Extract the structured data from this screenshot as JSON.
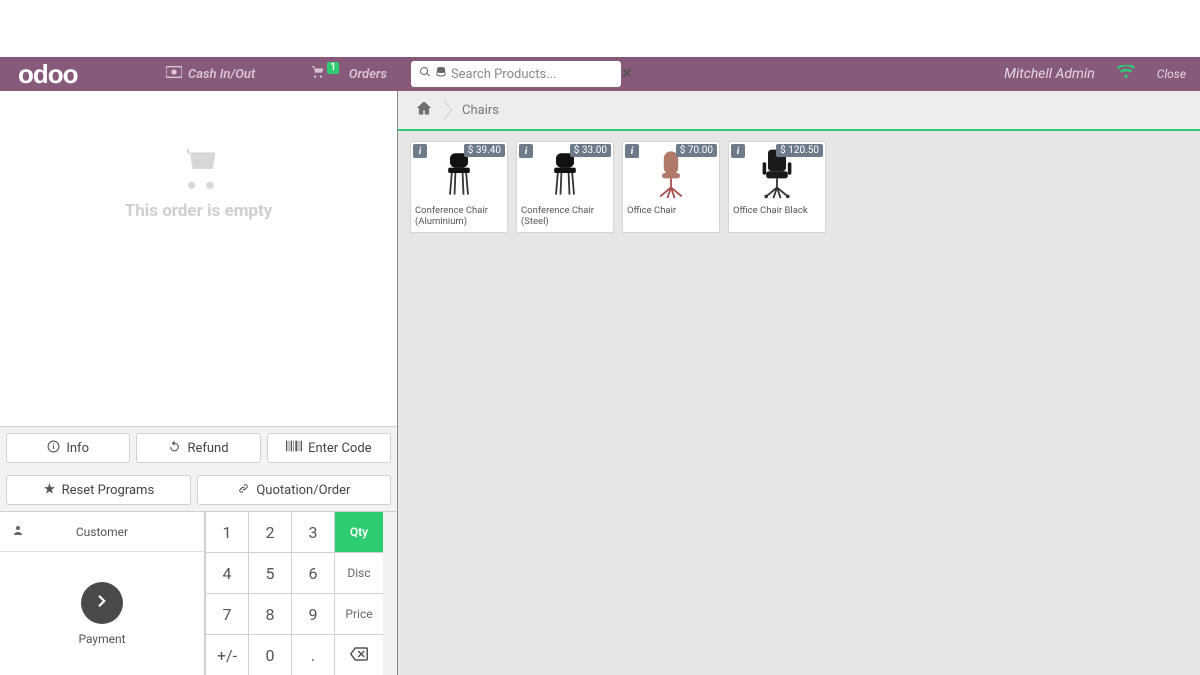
{
  "brand": "odoo",
  "topbar": {
    "cash_label": "Cash In/Out",
    "orders_label": "Orders",
    "orders_count": "1",
    "search_placeholder": "Search Products...",
    "user": "Mitchell Admin",
    "close_label": "Close"
  },
  "order": {
    "empty_message": "This order is empty"
  },
  "actions": {
    "info": "Info",
    "refund": "Refund",
    "enter_code": "Enter Code",
    "reset_programs": "Reset Programs",
    "quotation_order": "Quotation/Order"
  },
  "customer_pad": {
    "customer_label": "Customer",
    "payment_label": "Payment"
  },
  "numpad": {
    "k1": "1",
    "k2": "2",
    "k3": "3",
    "k4": "4",
    "k5": "5",
    "k6": "6",
    "k7": "7",
    "k8": "8",
    "k9": "9",
    "pm": "+/-",
    "k0": "0",
    "dot": ".",
    "qty": "Qty",
    "disc": "Disc",
    "price": "Price"
  },
  "breadcrumbs": {
    "current": "Chairs"
  },
  "products": [
    {
      "name": "Conference Chair (Aluminium)",
      "price": "$ 39.40",
      "variant": "black"
    },
    {
      "name": "Conference Chair (Steel)",
      "price": "$ 33.00",
      "variant": "black"
    },
    {
      "name": "Office Chair",
      "price": "$ 70.00",
      "variant": "brown"
    },
    {
      "name": "Office Chair Black",
      "price": "$ 120.50",
      "variant": "office-black"
    }
  ]
}
